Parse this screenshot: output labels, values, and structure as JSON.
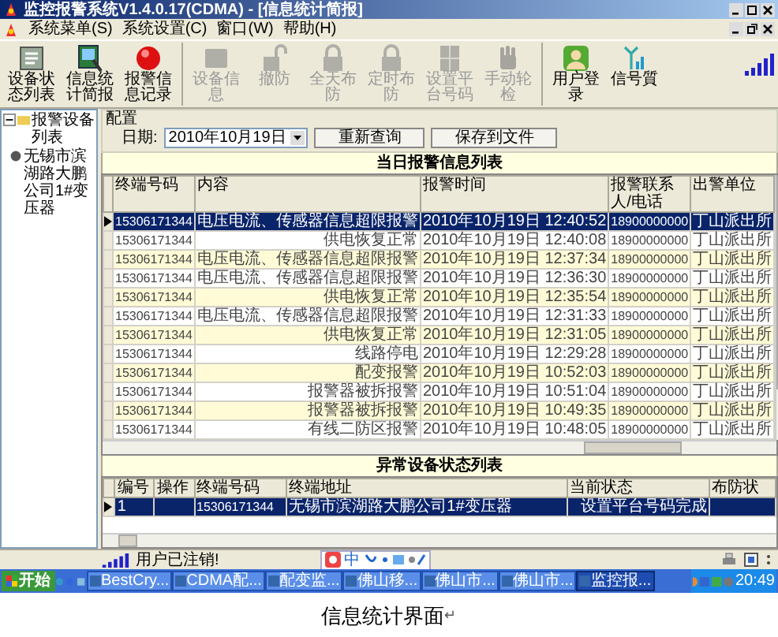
{
  "window": {
    "title": "监控报警系统V1.4.0.17(CDMA) - [信息统计简报]"
  },
  "menu": [
    {
      "label": "系统菜单(S)"
    },
    {
      "label": "系统设置(C)"
    },
    {
      "label": "窗口(W)"
    },
    {
      "label": "帮助(H)"
    }
  ],
  "toolbar": [
    {
      "kind": "list",
      "label": "设备状态列表",
      "disabled": false
    },
    {
      "kind": "report",
      "label": "信息统计简报",
      "disabled": false
    },
    {
      "kind": "alarm",
      "label": "报警信息记录",
      "disabled": false
    },
    {
      "kind": "device",
      "label": "设备信息",
      "disabled": true
    },
    {
      "kind": "unlock",
      "label": "撤防",
      "disabled": true
    },
    {
      "kind": "lock",
      "label": "全天布防",
      "disabled": true
    },
    {
      "kind": "lock",
      "label": "定时布防",
      "disabled": true
    },
    {
      "kind": "grid",
      "label": "设置平台号码",
      "disabled": true
    },
    {
      "kind": "hand",
      "label": "手动轮检",
      "disabled": true
    },
    {
      "kind": "user",
      "label": "用户登录",
      "disabled": false
    },
    {
      "kind": "antenna",
      "label": "信号質",
      "disabled": false
    }
  ],
  "tree": {
    "label": "报警设备列表",
    "expanded": true,
    "children": [
      {
        "label": "无锡市滨湖路大鹏公司1#变压器"
      }
    ]
  },
  "config": {
    "group_label": "配置",
    "date_label": "日期:",
    "date_value": "2010年10月19日",
    "buttons": [
      "重新查询",
      "保存到文件"
    ]
  },
  "alarm_table": {
    "title": "当日报警信息列表",
    "columns": [
      "终端号码",
      "内容",
      "报警时间",
      "报警联系人/电话",
      "出警单位"
    ],
    "rows": [
      {
        "terminal": "15306171344",
        "content": "电压电流、传感器信息超限报警",
        "time": "2010年10月19日 12:40:52",
        "contact": "18900000000",
        "unit": "丁山派出所",
        "selected": true
      },
      {
        "terminal": "15306171344",
        "content": "供电恢复正常",
        "time": "2010年10月19日 12:40:08",
        "contact": "18900000000",
        "unit": "丁山派出所",
        "selected": false
      },
      {
        "terminal": "15306171344",
        "content": "电压电流、传感器信息超限报警",
        "time": "2010年10月19日 12:37:34",
        "contact": "18900000000",
        "unit": "丁山派出所",
        "selected": false
      },
      {
        "terminal": "15306171344",
        "content": "电压电流、传感器信息超限报警",
        "time": "2010年10月19日 12:36:30",
        "contact": "18900000000",
        "unit": "丁山派出所",
        "selected": false
      },
      {
        "terminal": "15306171344",
        "content": "供电恢复正常",
        "time": "2010年10月19日 12:35:54",
        "contact": "18900000000",
        "unit": "丁山派出所",
        "selected": false
      },
      {
        "terminal": "15306171344",
        "content": "电压电流、传感器信息超限报警",
        "time": "2010年10月19日 12:31:33",
        "contact": "18900000000",
        "unit": "丁山派出所",
        "selected": false
      },
      {
        "terminal": "15306171344",
        "content": "供电恢复正常",
        "time": "2010年10月19日 12:31:05",
        "contact": "18900000000",
        "unit": "丁山派出所",
        "selected": false
      },
      {
        "terminal": "15306171344",
        "content": "线路停电",
        "time": "2010年10月19日 12:29:28",
        "contact": "18900000000",
        "unit": "丁山派出所",
        "selected": false
      },
      {
        "terminal": "15306171344",
        "content": "配变报警",
        "time": "2010年10月19日 10:52:03",
        "contact": "18900000000",
        "unit": "丁山派出所",
        "selected": false
      },
      {
        "terminal": "15306171344",
        "content": "报警器被拆报警",
        "time": "2010年10月19日 10:51:04",
        "contact": "18900000000",
        "unit": "丁山派出所",
        "selected": false
      },
      {
        "terminal": "15306171344",
        "content": "报警器被拆报警",
        "time": "2010年10月19日 10:49:35",
        "contact": "18900000000",
        "unit": "丁山派出所",
        "selected": false
      },
      {
        "terminal": "15306171344",
        "content": "有线二防区报警",
        "time": "2010年10月19日 10:48:05",
        "contact": "18900000000",
        "unit": "丁山派出所",
        "selected": false
      }
    ]
  },
  "status_table": {
    "title": "异常设备状态列表",
    "columns": [
      "编号",
      "操作",
      "终端号码",
      "终端地址",
      "当前状态",
      "布防状"
    ],
    "rows": [
      {
        "number": "1",
        "terminal": "15306171344",
        "address": "无锡市滨湖路大鹏公司1#变压器",
        "state": "设置平台号码完成",
        "selected": true
      }
    ]
  },
  "status_bar": {
    "text": "用户已注销!",
    "ime_label": "中"
  },
  "taskbar": {
    "start": "开始",
    "items": [
      {
        "label": "BestCry...",
        "selected": false
      },
      {
        "label": "CDMA配...",
        "selected": false
      },
      {
        "label": "配变监...",
        "selected": false
      },
      {
        "label": "佛山移...",
        "selected": false
      },
      {
        "label": "佛山市...",
        "selected": false
      },
      {
        "label": "佛山市...",
        "selected": false
      },
      {
        "label": "监控报...",
        "selected": true
      }
    ],
    "clock": "20:49"
  },
  "caption": {
    "text": "信息统计界面",
    "paragraph_mark": "↵"
  }
}
